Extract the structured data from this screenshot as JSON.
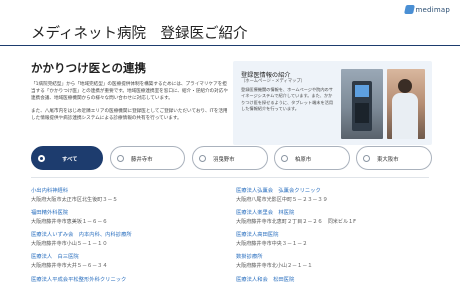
{
  "header": {
    "logo_text": "medimap",
    "page_title": "メディネット病院　登録医ご紹介"
  },
  "section": {
    "title": "かかりつけ医との連携",
    "intro_p1": "「1病院完結型」から「地域完結型」の医療提供体制を構築するためには、プライマリケアを担当する「かかりつけ医」との連携が重要です。地域医療連携室を窓口に、紹介・逆紹介の対応や連携会議、地域医療機関からの様々な問い合わせに対応しています。",
    "intro_p2": "また、八尾市内をはじめ近隣エリアの医療機関に登録医としてご登録いただいており、ITを活用した情報提供や病診連携システムによる診療情報の共有を行っています。"
  },
  "info_box": {
    "title": "登録医情報の紹介",
    "subtitle": "（ホームページ・メディマップ）",
    "text": "登録医療機関の情報を、ホームページや院内のサイネージシステムで紹介しています。また、かかりつけ医を探せるように、タブレット端末を活用した情報紹介を行っています。"
  },
  "filters": [
    {
      "label": "すべて"
    },
    {
      "label": "藤井寺市"
    },
    {
      "label": "羽曳野市"
    },
    {
      "label": "柏原市"
    },
    {
      "label": "東大阪市"
    }
  ],
  "hospitals": [
    {
      "name": "小出内科神経科",
      "address": "大阪府大阪市太正市区北生後町３－５"
    },
    {
      "name": "医療法人弘薫会　弘薫会クリニック",
      "address": "大阪府八尾市光影区中町５－２３－３９"
    },
    {
      "name": "福田精外科医院",
      "address": "大阪府藤井寺市恵美坂１－６－６"
    },
    {
      "name": "医療法人楽里会　林医院",
      "address": "大阪府藤井寺市北恵町２丁目２－２６　同米ビル１F"
    },
    {
      "name": "医療法人いずみ会　内本内科、内科診療所",
      "address": "大阪府藤井寺市小山５－１－１０"
    },
    {
      "name": "医療法人高田医院",
      "address": "大阪府藤井寺市中央３－１－２"
    },
    {
      "name": "医療法人　白三医院",
      "address": "大阪府藤井寺市大井５－６－３４"
    },
    {
      "name": "数掛診療所",
      "address": "大阪府藤井寺市北小山２－１－１"
    },
    {
      "name": "医療法人平成会平松整形外科クリニック",
      "address": ""
    },
    {
      "name": "医療法人和会　松田医院",
      "address": ""
    }
  ]
}
